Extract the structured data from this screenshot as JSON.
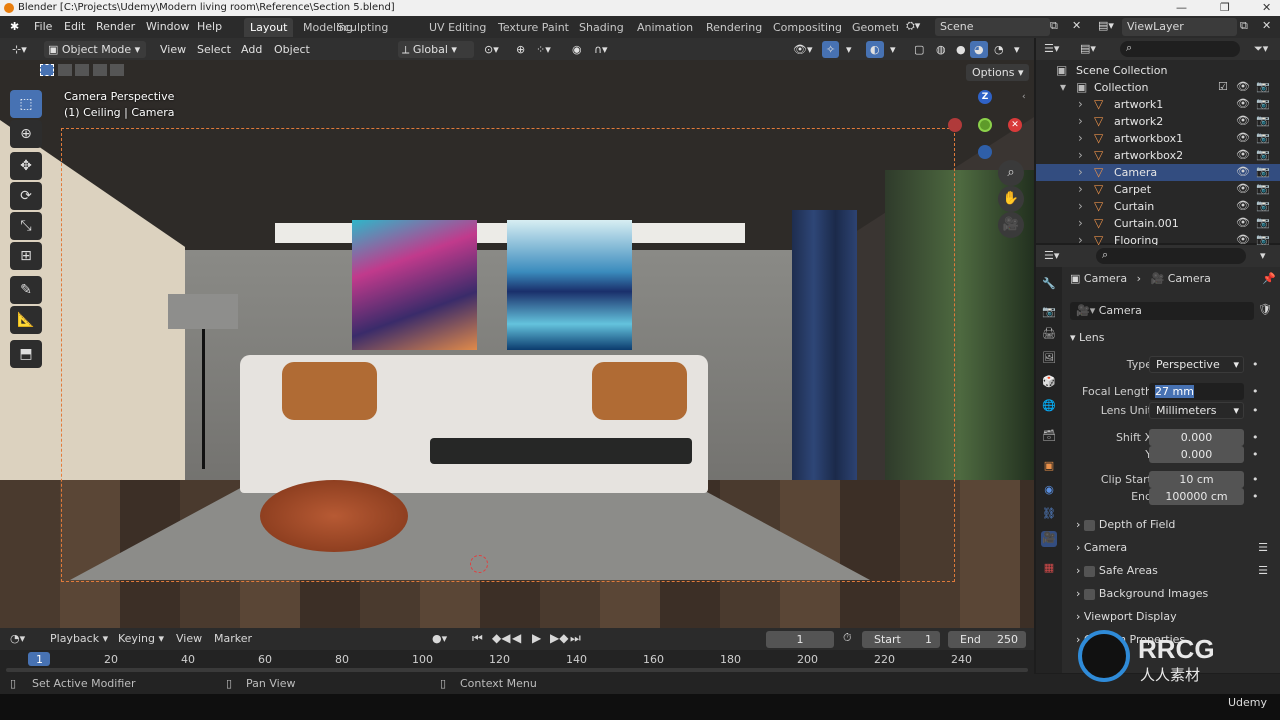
{
  "titlebar": {
    "title": "Blender [C:\\Projects\\Udemy\\Modern living room\\Reference\\Section 5.blend]"
  },
  "menubar": {
    "items": [
      "File",
      "Edit",
      "Render",
      "Window",
      "Help"
    ],
    "workspaces": [
      "Layout",
      "Modeling",
      "Sculpting",
      "UV Editing",
      "Texture Paint",
      "Shading",
      "Animation",
      "Rendering",
      "Compositing",
      "Geometr"
    ],
    "active_workspace": "Layout",
    "scene": "Scene",
    "view_layer": "ViewLayer"
  },
  "viewport_header": {
    "mode": "Object Mode",
    "menus": [
      "View",
      "Select",
      "Add",
      "Object"
    ],
    "orientation": "Global",
    "options": "Options"
  },
  "viewport": {
    "line1": "Camera Perspective",
    "line2": "(1) Ceiling | Camera",
    "gizmo": {
      "z": "Z"
    }
  },
  "outliner": {
    "root": "Scene Collection",
    "collection": "Collection",
    "items": [
      {
        "name": "artwork1",
        "selected": false
      },
      {
        "name": "artwork2",
        "selected": false
      },
      {
        "name": "artworkbox1",
        "selected": false
      },
      {
        "name": "artworkbox2",
        "selected": false
      },
      {
        "name": "Camera",
        "selected": true
      },
      {
        "name": "Carpet",
        "selected": false
      },
      {
        "name": "Curtain",
        "selected": false
      },
      {
        "name": "Curtain.001",
        "selected": false
      },
      {
        "name": "Flooring",
        "selected": false
      }
    ]
  },
  "properties": {
    "breadcrumb_obj": "Camera",
    "breadcrumb_data": "Camera",
    "datablock": "Camera",
    "lens": {
      "header": "Lens",
      "type_label": "Type",
      "type_value": "Perspective",
      "focal_label": "Focal Length",
      "focal_value": "27 mm",
      "unit_label": "Lens Unit",
      "unit_value": "Millimeters",
      "shiftx_label": "Shift X",
      "shiftx_value": "0.000",
      "shifty_label": "Y",
      "shifty_value": "0.000",
      "clipstart_label": "Clip Start",
      "clipstart_value": "10 cm",
      "clipend_label": "End",
      "clipend_value": "100000 cm"
    },
    "panels": [
      "Depth of Field",
      "Camera",
      "Safe Areas",
      "Background Images",
      "Viewport Display",
      "Custom Properties"
    ]
  },
  "timeline": {
    "menus": [
      "Playback",
      "Keying",
      "View",
      "Marker"
    ],
    "current_frame": "1",
    "start_label": "Start",
    "start_value": "1",
    "end_label": "End",
    "end_value": "250",
    "ticks": [
      "1",
      "20",
      "40",
      "60",
      "80",
      "100",
      "120",
      "140",
      "160",
      "180",
      "200",
      "220",
      "240"
    ]
  },
  "statusbar": {
    "hint1": "Set Active Modifier",
    "hint2": "Pan View",
    "hint3": "Context Menu"
  },
  "watermark": {
    "brand": "RRCG",
    "sub": "人人素材",
    "footer": "Udemy"
  },
  "colors": {
    "accent": "#4772b3",
    "selection": "#334d80",
    "camera_frame": "#e07a3a"
  }
}
